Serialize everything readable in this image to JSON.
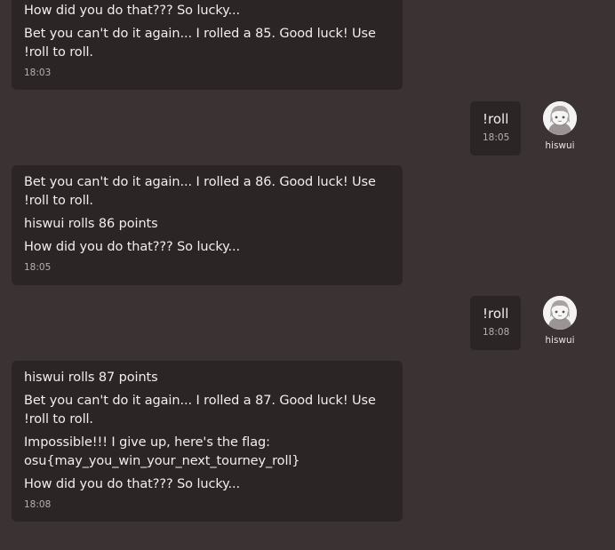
{
  "colors": {
    "background": "#3a3233",
    "bubble": "#2b2526",
    "text": "#f2eeee",
    "timestamp": "#b8b0b0"
  },
  "messages": [
    {
      "side": "bot",
      "lines": [
        "How did you do that??? So lucky...",
        "Bet you can't do it again... I rolled a 85. Good luck! Use !roll to roll."
      ],
      "time": "18:03"
    },
    {
      "side": "user",
      "text": "!roll",
      "time": "18:05",
      "user": "hiswui",
      "avatar_icon": "anime-avatar-icon"
    },
    {
      "side": "bot",
      "lines": [
        "Bet you can't do it again... I rolled a 86. Good luck! Use !roll to roll.",
        "hiswui rolls 86 points",
        "How did you do that??? So lucky..."
      ],
      "time": "18:05"
    },
    {
      "side": "user",
      "text": "!roll",
      "time": "18:08",
      "user": "hiswui",
      "avatar_icon": "anime-avatar-icon"
    },
    {
      "side": "bot",
      "lines": [
        "hiswui rolls 87 points",
        "Bet you can't do it again... I rolled a 87. Good luck! Use !roll to roll.",
        "Impossible!!! I give up, here's the flag: osu{may_you_win_your_next_tourney_roll}",
        "How did you do that??? So lucky..."
      ],
      "time": "18:08"
    }
  ]
}
